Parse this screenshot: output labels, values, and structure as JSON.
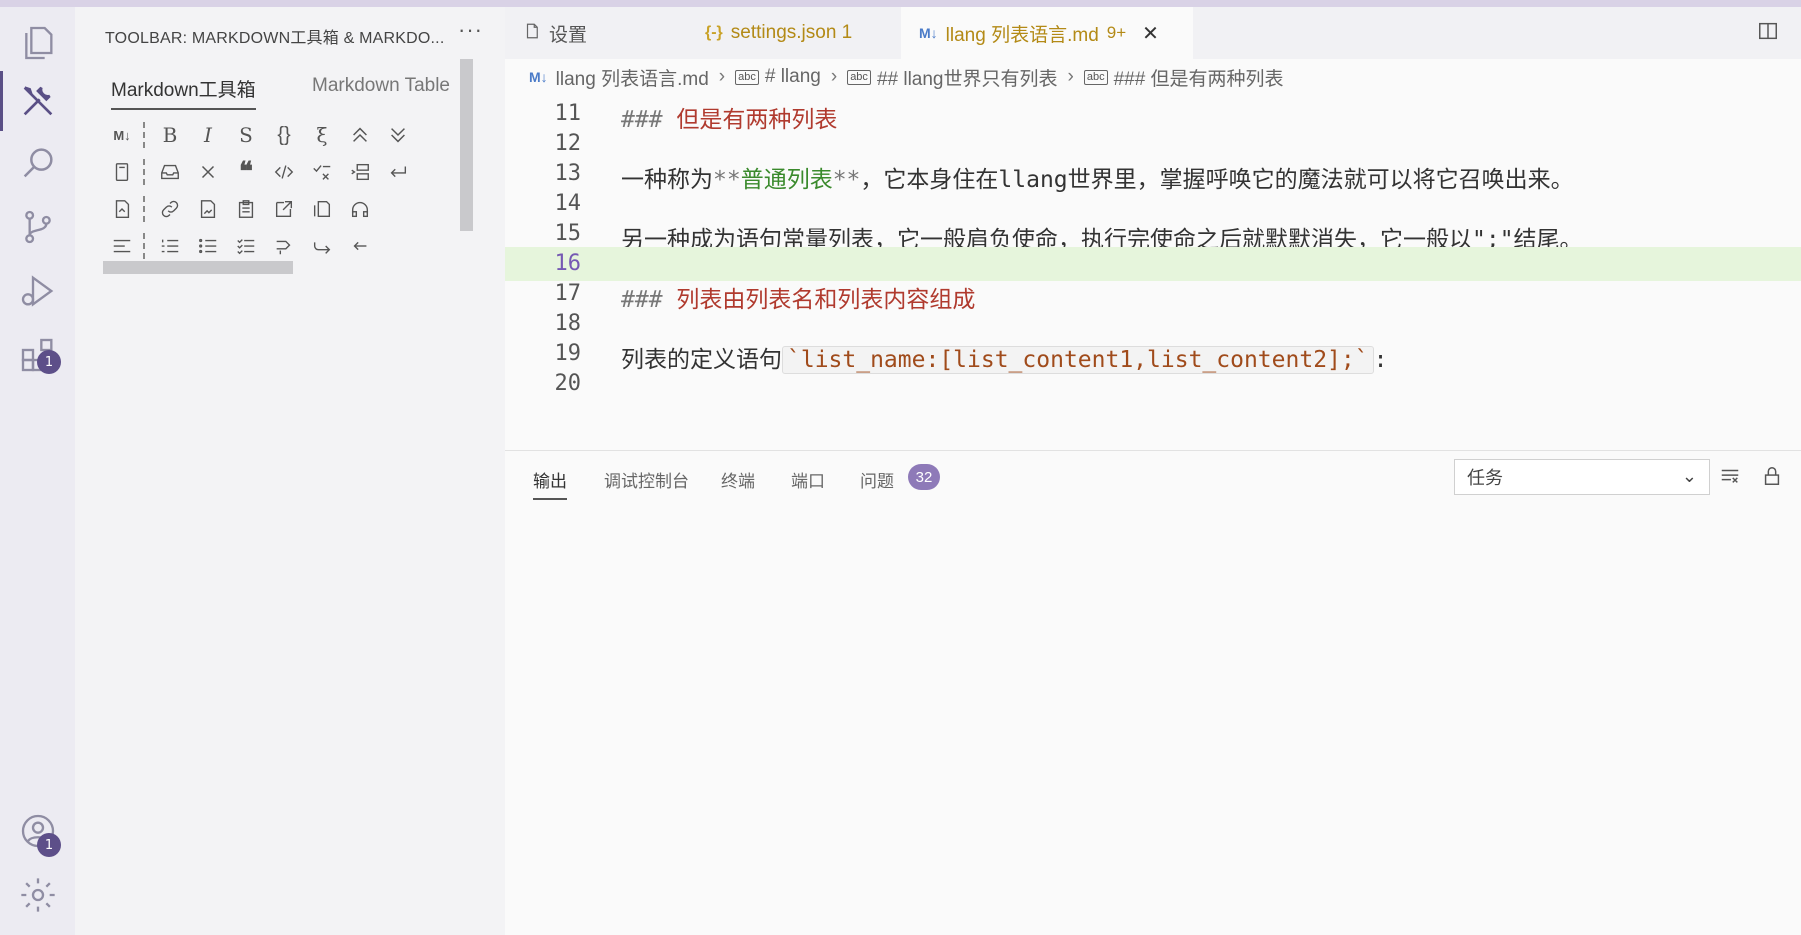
{
  "activity_bar": {
    "items": [
      {
        "name": "explorer-icon"
      },
      {
        "name": "tools-icon",
        "active": true
      },
      {
        "name": "search-icon"
      },
      {
        "name": "source-control-icon"
      },
      {
        "name": "run-debug-icon"
      },
      {
        "name": "extensions-icon",
        "badge": "1"
      },
      {
        "name": "account-icon",
        "badge": "1"
      },
      {
        "name": "gear-icon"
      }
    ]
  },
  "sidebar": {
    "title": "TOOLBAR: MARKDOWN工具箱 & MARKDO...",
    "more": "···",
    "tabs": [
      "Markdown工具箱",
      "Markdown Table"
    ]
  },
  "tabs": [
    {
      "icon": "file-icon",
      "label": "设置"
    },
    {
      "icon": "{-}",
      "label": "settings.json 1",
      "color": "#b38a16"
    },
    {
      "icon": "M↓",
      "label": "llang 列表语言.md",
      "badge": "9+",
      "color": "#b38a16",
      "active": true,
      "close": "✕"
    }
  ],
  "breadcrumb": {
    "file": "llang 列表语言.md",
    "items": [
      "# llang",
      "## llang世界只有列表",
      "### 但是有两种列表"
    ],
    "symbol_icon": "abc"
  },
  "editor": {
    "lines": [
      {
        "n": "11",
        "parts": [
          {
            "t": "### ",
            "c": "mk"
          },
          {
            "t": "但是有两种列表",
            "c": "h"
          }
        ]
      },
      {
        "n": "12",
        "parts": []
      },
      {
        "n": "13",
        "parts": [
          {
            "t": "一种称为",
            "c": ""
          },
          {
            "t": "**",
            "c": "mk"
          },
          {
            "t": "普通列表",
            "c": "strong"
          },
          {
            "t": "**",
            "c": "mk"
          },
          {
            "t": "，它本身住在llang世界里，掌握呼唤它的魔法就可以将它召唤出来。",
            "c": ""
          }
        ]
      },
      {
        "n": "14",
        "parts": []
      },
      {
        "n": "15",
        "parts": [
          {
            "t": "另一种成为语句常量列表，它一般肩负使命，执行完使命之后就默默消失，它一般以\";\"结尾。",
            "c": ""
          }
        ]
      },
      {
        "n": "16",
        "parts": [],
        "current": true
      },
      {
        "n": "17",
        "parts": [
          {
            "t": "### ",
            "c": "mk"
          },
          {
            "t": "列表由列表名和列表内容组成",
            "c": "h"
          }
        ]
      },
      {
        "n": "18",
        "parts": []
      },
      {
        "n": "19",
        "parts": [
          {
            "t": "列表的定义语句",
            "c": ""
          },
          {
            "t": "`list_name:[list_content1,list_content2];`",
            "c": "code"
          },
          {
            "t": ":",
            "c": ""
          }
        ]
      },
      {
        "n": "20",
        "parts": []
      }
    ]
  },
  "panel": {
    "tabs": [
      "输出",
      "调试控制台",
      "终端",
      "端口",
      "问题"
    ],
    "problems_count": "32",
    "select_value": "任务"
  },
  "colors": {
    "accent": "#5a4f86",
    "heading": "#b03a2e",
    "bold": "#3a8a2c",
    "current_line": "#e6f5dc"
  }
}
